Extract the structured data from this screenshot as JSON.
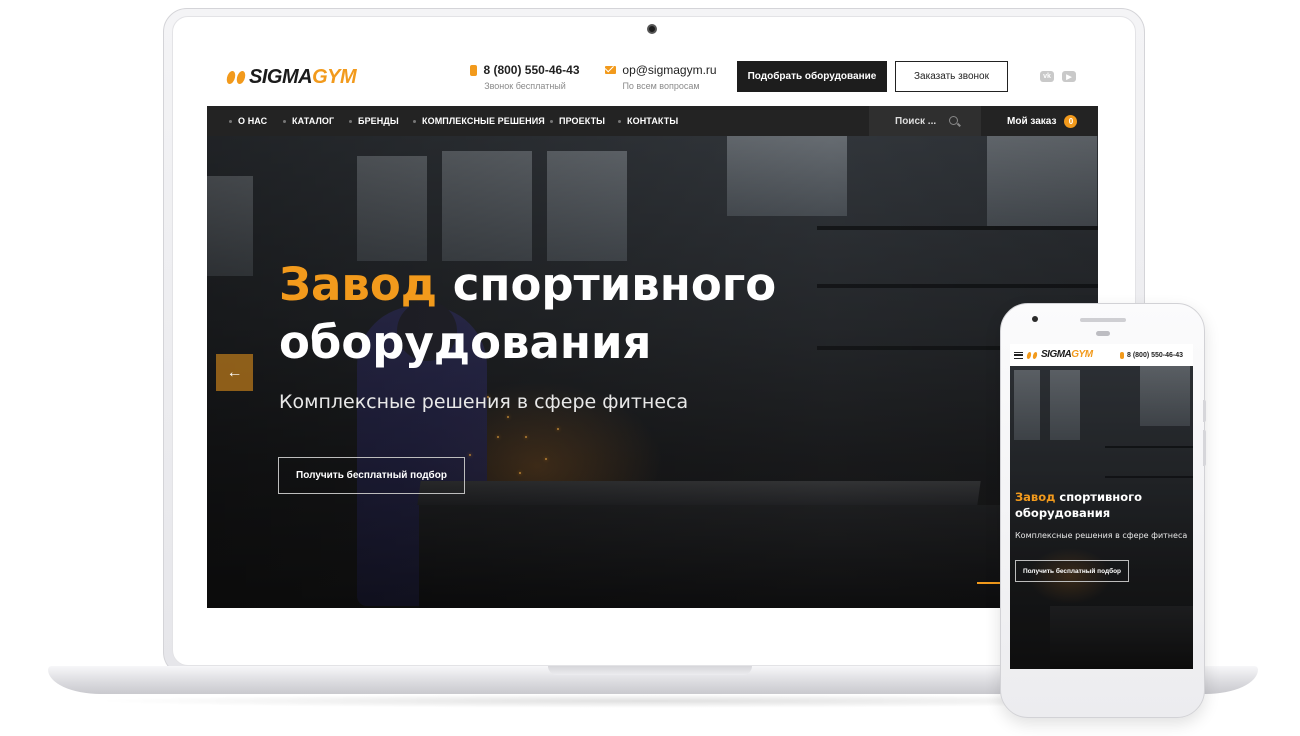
{
  "brand": {
    "logo_part1": "SIGMA",
    "logo_part2": "GYM",
    "accent": "#f29a1c",
    "dark": "#232323"
  },
  "header": {
    "phone": {
      "number": "8 (800) 550-46-43",
      "caption": "Звонок бесплатный",
      "icon": "phone-icon"
    },
    "email": {
      "address": "op@sigmagym.ru",
      "caption": "По всем вопросам",
      "icon": "mail-icon"
    },
    "primary_button": "Подобрать оборудование",
    "secondary_button": "Заказать звонок",
    "social": [
      {
        "name": "vk-icon",
        "glyph": "vk"
      },
      {
        "name": "youtube-icon",
        "glyph": "▶"
      }
    ]
  },
  "nav": {
    "items": [
      "О НАС",
      "КАТАЛОГ",
      "БРЕНДЫ",
      "КОМПЛЕКСНЫЕ РЕШЕНИЯ",
      "ПРОЕКТЫ",
      "КОНТАКТЫ"
    ],
    "search_placeholder": "Поиск ...",
    "order_label": "Мой заказ",
    "order_count": "0"
  },
  "hero": {
    "title_highlight": "Завод",
    "title_rest_line1": " спортивного",
    "title_line2": "оборудования",
    "subtitle": "Комплексные решения в сфере фитнеса",
    "cta": "Получить бесплатный подбор",
    "prev_arrow": "←"
  },
  "mobile": {
    "phone": "8 (800) 550-46-43",
    "title_highlight": "Завод",
    "title_rest_line1": " спортивного",
    "title_line2": "оборудования",
    "subtitle": "Комплексные решения в сфере фитнеса",
    "cta": "Получить бесплатный подбор"
  }
}
